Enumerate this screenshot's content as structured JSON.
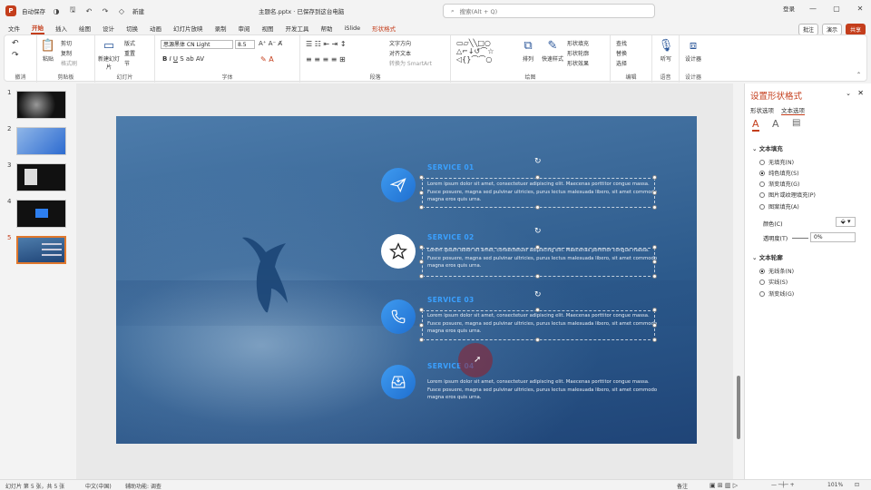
{
  "titlebar": {
    "autosave": "自动保存",
    "new": "新建",
    "filename": "主题名.pptx · 已保存到这台电脑",
    "search_placeholder": "搜索(Alt + Q)",
    "user": "登录"
  },
  "menus": [
    "文件",
    "开始",
    "插入",
    "绘图",
    "设计",
    "切换",
    "动画",
    "幻灯片放映",
    "录制",
    "审阅",
    "视图",
    "开发工具",
    "帮助",
    "iSlide",
    "形状格式"
  ],
  "menu_active": "开始",
  "menu_right": {
    "comment": "批注",
    "present": "演示",
    "share": "共享"
  },
  "ribbon": {
    "groups": [
      "撤消",
      "剪贴板",
      "幻灯片",
      "字体",
      "段落",
      "绘图",
      "编辑",
      "语音",
      "设计器"
    ],
    "clipboard": {
      "paste": "粘贴",
      "cut": "剪切",
      "copy": "复制",
      "format_painter": "格式刷"
    },
    "slides": {
      "new_slide": "新建幻灯片",
      "layout": "版式",
      "reset": "重置",
      "section": "节"
    },
    "font": {
      "name": "思源黑体 CN Light",
      "size": "8.5"
    },
    "paragraph": {
      "text_direction": "文字方向",
      "align_text": "对齐文本",
      "smartart": "转换为 SmartArt"
    },
    "drawing": {
      "arrange": "排列",
      "quick_styles": "快速样式",
      "fill": "形状填充",
      "outline": "形状轮廓",
      "effects": "形状效果"
    },
    "editing": {
      "find": "查找",
      "replace": "替换",
      "select": "选择"
    },
    "voice": {
      "dictate": "听写"
    },
    "designer": {
      "label": "设计器"
    }
  },
  "thumbnails": [
    "1",
    "2",
    "3",
    "4",
    "5"
  ],
  "selected_thumbnail": "5",
  "slide": {
    "services": [
      {
        "title": "SERVICE 01",
        "text": "Lorem ipsum dolor sit amet, consectetuer adipiscing elit. Maecenas porttitor congue massa. Fusce posuere, magna sed pulvinar ultricies, purus lectus malesuada libero, sit amet commodo magna eros quis urna.",
        "icon": "paper-plane-icon"
      },
      {
        "title": "SERVICE 02",
        "text": "Lorem ipsum dolor sit amet, consectetuer adipiscing elit. Maecenas porttitor congue massa. Fusce posuere, magna sed pulvinar ultricies, purus lectus malesuada libero, sit amet commodo magna eros quis urna.",
        "icon": "star-icon"
      },
      {
        "title": "SERVICE 03",
        "text": "Lorem ipsum dolor sit amet, consectetuer adipiscing elit. Maecenas porttitor congue massa. Fusce posuere, magna sed pulvinar ultricies, purus lectus malesuada libero, sit amet commodo magna eros quis urna.",
        "icon": "phone-icon"
      },
      {
        "title": "SERVICE 04",
        "text": "Lorem ipsum dolor sit amet, consectetuer adipiscing elit. Maecenas porttitor congue massa. Fusce posuere, magna sed pulvinar ultricies, purus lectus malesuada libero, sit amet commodo magna eros quis urna.",
        "icon": "inbox-icon"
      }
    ]
  },
  "format_pane": {
    "title": "设置形状格式",
    "tabs": [
      "形状选项",
      "文本选项"
    ],
    "fill_section": "文本填充",
    "fill_options": [
      "无填充(N)",
      "纯色填充(S)",
      "渐变填充(G)",
      "图片或纹理填充(P)",
      "图案填充(A)"
    ],
    "fill_selected": "纯色填充(S)",
    "color_label": "颜色(C)",
    "transparency_label": "透明度(T)",
    "transparency_value": "0%",
    "outline_section": "文本轮廓",
    "outline_options": [
      "无线条(N)",
      "实线(S)",
      "渐变线(G)"
    ],
    "outline_selected": "无线条(N)"
  },
  "status": {
    "slide_info": "幻灯片 第 5 张，共 5 张",
    "language": "中文(中国)",
    "accessibility": "辅助功能: 调查",
    "notes": "备注",
    "zoom": "101%"
  },
  "colors": {
    "accent": "#c43e1c",
    "service_title": "#3aa0ff"
  }
}
